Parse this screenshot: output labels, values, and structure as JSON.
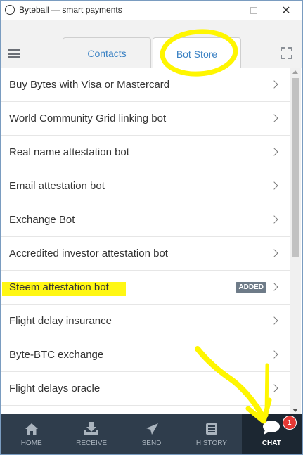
{
  "window": {
    "title": "Byteball — smart payments",
    "minimize_glyph": "",
    "maximize_glyph": "",
    "close_glyph": "✕"
  },
  "tabs": [
    {
      "label": "Contacts",
      "active": false
    },
    {
      "label": "Bot Store",
      "active": true
    }
  ],
  "bots": [
    {
      "label": "Buy Bytes with Visa or Mastercard"
    },
    {
      "label": "World Community Grid linking bot"
    },
    {
      "label": "Real name attestation bot"
    },
    {
      "label": "Email attestation bot"
    },
    {
      "label": "Exchange Bot"
    },
    {
      "label": "Accredited investor attestation bot"
    },
    {
      "label": "Steem attestation bot",
      "badge": "ADDED"
    },
    {
      "label": "Flight delay insurance"
    },
    {
      "label": "Byte-BTC exchange"
    },
    {
      "label": "Flight delays oracle"
    }
  ],
  "nav": [
    {
      "label": "HOME",
      "icon": "home-icon"
    },
    {
      "label": "RECEIVE",
      "icon": "receive-icon"
    },
    {
      "label": "SEND",
      "icon": "send-icon"
    },
    {
      "label": "HISTORY",
      "icon": "history-icon"
    },
    {
      "label": "CHAT",
      "icon": "chat-icon",
      "active": true,
      "badge": "1"
    }
  ],
  "colors": {
    "tab_text": "#3b82c4",
    "nav_bg": "#2f3d4c",
    "nav_active_bg": "#1c2732",
    "badge_bg": "#6e7b88",
    "notification": "#e53935",
    "annotation_yellow": "#fff600"
  }
}
